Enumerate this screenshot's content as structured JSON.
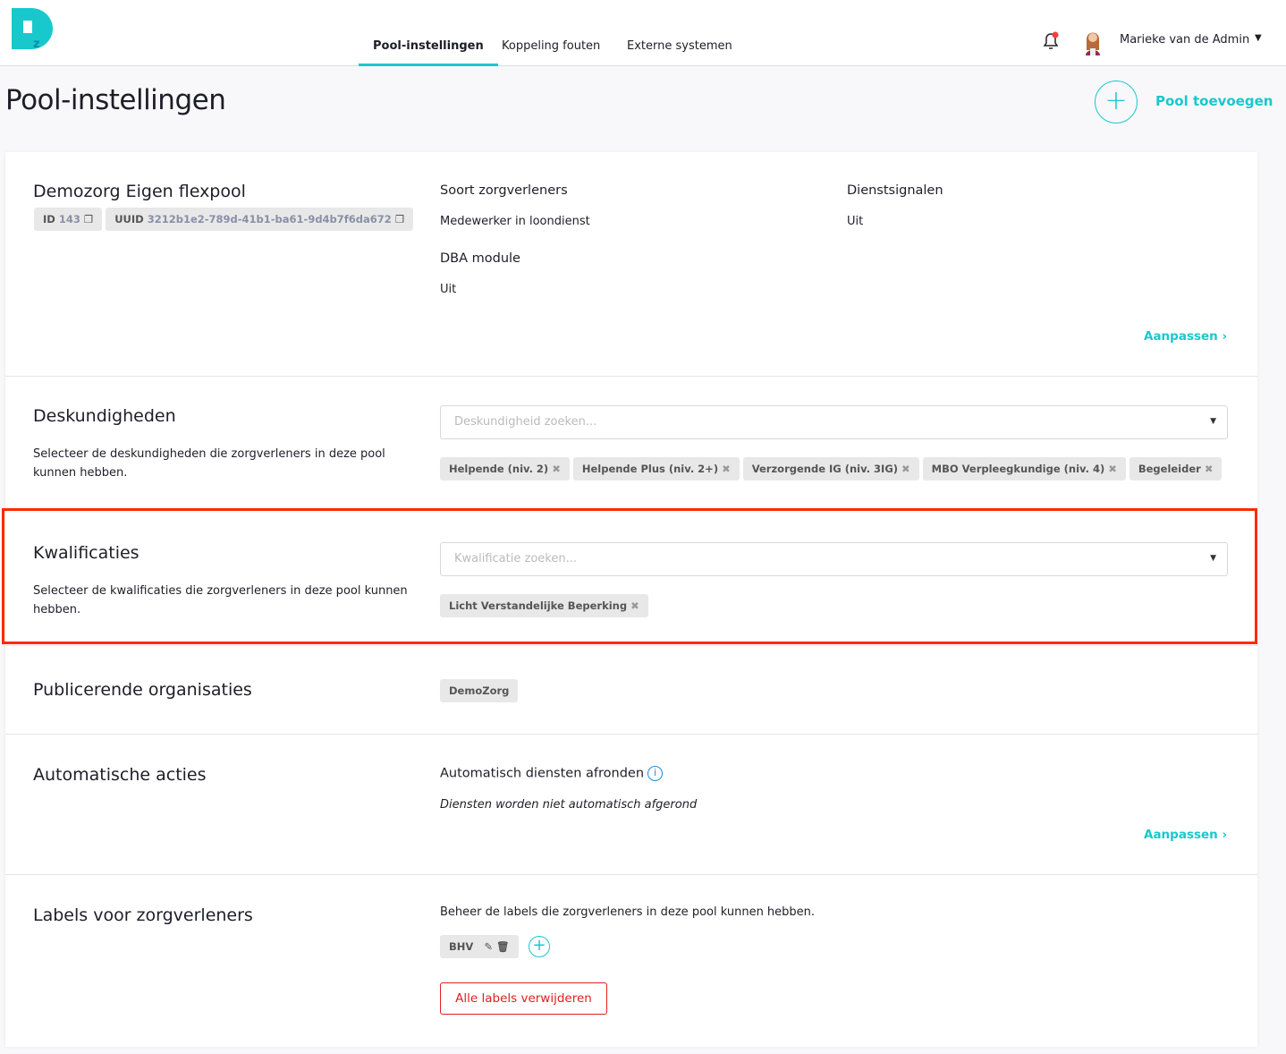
{
  "header": {
    "tabs": [
      {
        "label": "Pool-instellingen",
        "active": true
      },
      {
        "label": "Koppeling fouten"
      },
      {
        "label": "Externe systemen"
      }
    ],
    "user_name": "Marieke van de Admin",
    "brand_color": "#18c8cc"
  },
  "page": {
    "title": "Pool-instellingen",
    "add_pool_label": "Pool toevoegen"
  },
  "pool": {
    "name": "Demozorg Eigen flexpool",
    "id_label": "ID",
    "id": "143",
    "uuid_label": "UUID",
    "uuid": "3212b1e2-789d-41b1-ba61-9d4b7f6da672",
    "soort_label": "Soort zorgverleners",
    "soort_value": "Medewerker in loondienst",
    "dienst_label": "Dienstsignalen",
    "dienst_value": "Uit",
    "dba_label": "DBA module",
    "dba_value": "Uit",
    "edit_label": "Aanpassen"
  },
  "deskundigheden": {
    "title": "Deskundigheden",
    "description": "Selecteer de deskundigheden die zorgverleners in deze pool kunnen hebben.",
    "placeholder": "Deskundigheid zoeken...",
    "chips": [
      "Helpende (niv. 2)",
      "Helpende Plus (niv. 2+)",
      "Verzorgende IG (niv. 3IG)",
      "MBO Verpleegkundige (niv. 4)",
      "Begeleider"
    ]
  },
  "kwalificaties": {
    "title": "Kwalificaties",
    "description": "Selecteer de kwalificaties die zorgverleners in deze pool kunnen hebben.",
    "placeholder": "Kwalificatie zoeken...",
    "chips": [
      "Licht Verstandelijke Beperking"
    ]
  },
  "publicerende": {
    "title": "Publicerende organisaties",
    "chips": [
      "DemoZorg"
    ]
  },
  "automatisch": {
    "title": "Automatische acties",
    "setting_label": "Automatisch diensten afronden",
    "setting_value": "Diensten worden niet automatisch afgerond",
    "edit_label": "Aanpassen"
  },
  "labels": {
    "title": "Labels voor zorgverleners",
    "description": "Beheer de labels die zorgverleners in deze pool kunnen hebben.",
    "items": [
      "BHV"
    ],
    "delete_all_label": "Alle labels verwijderen"
  }
}
